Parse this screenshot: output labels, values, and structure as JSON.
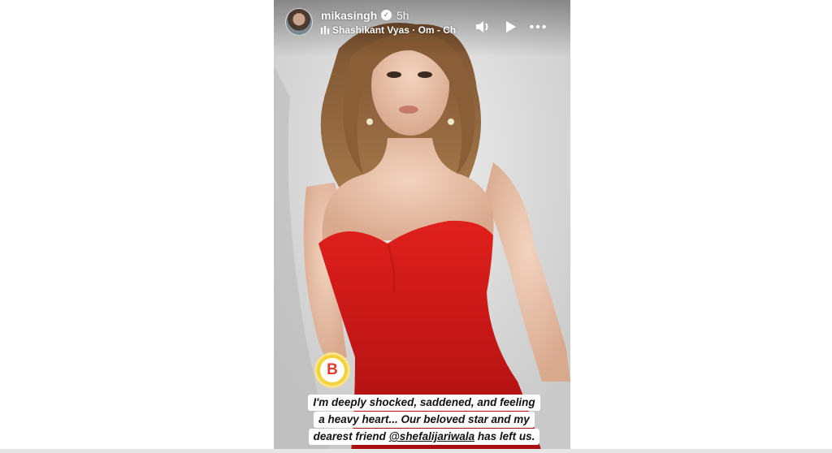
{
  "story": {
    "username": "mikasingh",
    "time_ago": "5h",
    "music": "Shashikant Vyas · Om - Ch",
    "brand_badge_letter": "B",
    "caption_lines": [
      "I'm deeply shocked, saddened, and feeling",
      "a heavy heart... Our beloved star and my",
      "dearest friend "
    ],
    "caption_mention": "@shefalijariwala",
    "caption_tail": " has left us.",
    "icons": {
      "verified": "verified-badge-icon",
      "music": "music-bars-icon",
      "volume": "volume-icon",
      "play": "play-icon",
      "more": "more-options-icon"
    }
  }
}
